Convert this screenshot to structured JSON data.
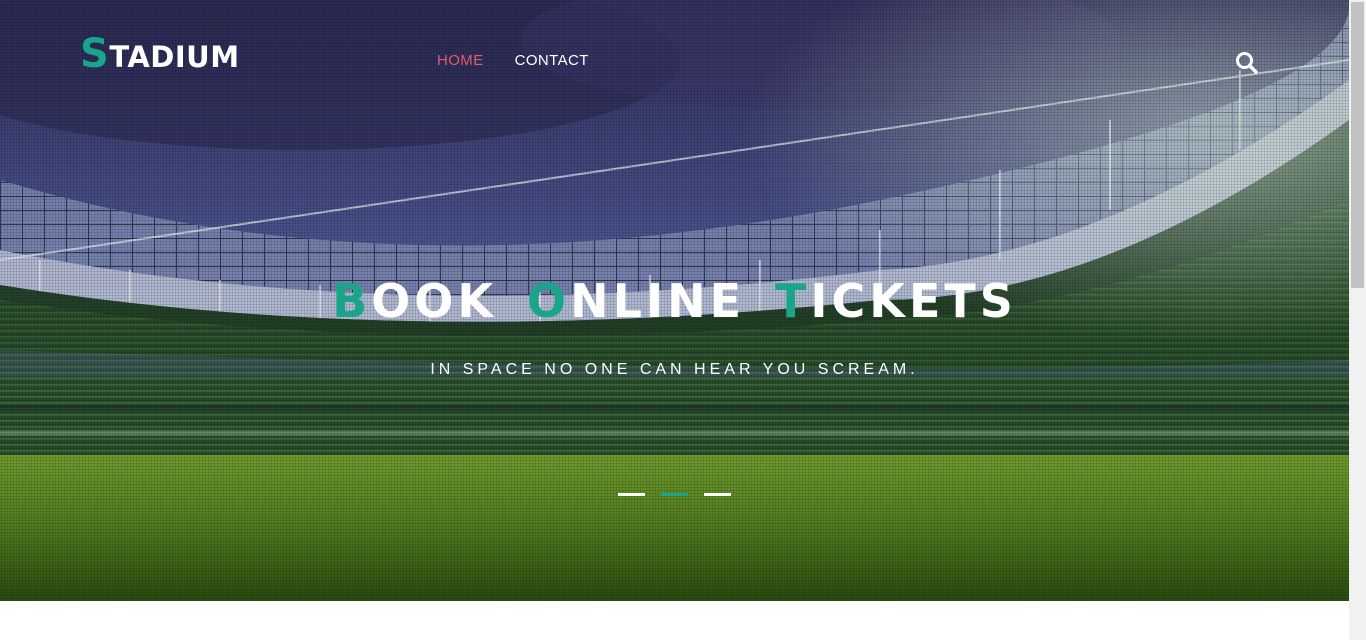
{
  "header": {
    "logo_first": "S",
    "logo_rest": "TADIUM",
    "nav": [
      {
        "label": "HOME",
        "active": true
      },
      {
        "label": "CONTACT",
        "active": false
      }
    ],
    "search_icon": "search-icon"
  },
  "hero": {
    "headline": [
      {
        "first": "B",
        "rest": "OOK"
      },
      {
        "first": "O",
        "rest": "NLINE"
      },
      {
        "first": "T",
        "rest": "ICKETS"
      }
    ],
    "subtitle": "IN SPACE NO ONE CAN HEAR YOU SCREAM.",
    "slides": 3,
    "active_slide": 2
  },
  "colors": {
    "accent": "#1aa58a",
    "nav_active": "#e05a6b",
    "nav_default": "#ffffff",
    "indicator_active": "#1aa58a",
    "indicator_default": "#ffffff"
  }
}
